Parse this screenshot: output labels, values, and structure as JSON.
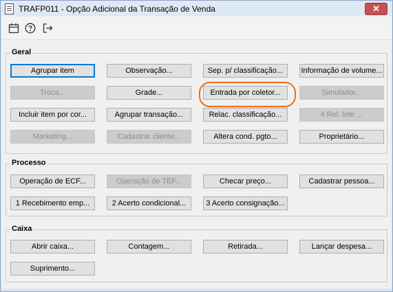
{
  "window": {
    "title": "TRAFP011 - Opção Adicional da Transação de Venda",
    "close_label": "✕"
  },
  "toolbar": {
    "icons": [
      "calendar-icon",
      "help-icon",
      "exit-icon"
    ]
  },
  "groups": {
    "geral": {
      "title": "Geral",
      "buttons": [
        "Agrupar item",
        "Observação...",
        "Sep. p/ classificação...",
        "Informação de volume...",
        "Troca...",
        "Grade...",
        "Entrada por coletor...",
        "Simulador...",
        "Incluir item por cor...",
        "Agrupar transação...",
        "Relac. classificação...",
        "4 Rel. lote ...",
        "Marketing...",
        "Cadastrar cliente...",
        "Altera cond. pgto...",
        "Proprietário..."
      ]
    },
    "processo": {
      "title": "Processo",
      "buttons": [
        "Operação de ECF...",
        "Operação de TEF...",
        "Checar preço...",
        "Cadastrar pessoa...",
        "1 Recebimento emp...",
        "2 Acerto condicional...",
        "3 Acerto consignação..."
      ]
    },
    "caixa": {
      "title": "Caixa",
      "buttons": [
        "Abrir caixa...",
        "Contagem...",
        "Retirada...",
        "Lançar despesa...",
        "Suprimento..."
      ]
    }
  }
}
